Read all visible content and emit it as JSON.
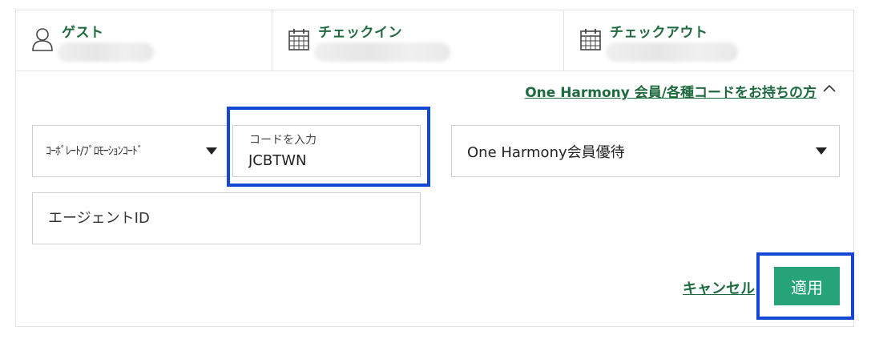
{
  "summary": {
    "guest_label": "ゲスト",
    "checkin_label": "チェックイン",
    "checkout_label": "チェックアウト"
  },
  "member_link": "One Harmony 会員/各種コードをお持ちの方",
  "corporate_select": {
    "selected": "ｺｰﾎﾟﾚｰﾄ/ﾌﾟﾛﾓｰｼｮﾝｺｰﾄﾞ"
  },
  "code_field": {
    "label": "コードを入力",
    "value": "JCBTWN"
  },
  "benefit_select": {
    "selected": "One Harmony会員優待"
  },
  "agent_field": {
    "placeholder": "エージェントID"
  },
  "actions": {
    "cancel": "キャンセル",
    "apply": "適用"
  },
  "colors": {
    "brand_green": "#1f6b3f",
    "apply_bg": "#27a37a",
    "highlight": "#1447d6"
  },
  "icons": [
    "user-icon",
    "calendar-icon",
    "calendar-icon",
    "chevron-up-icon",
    "caret-down-icon"
  ]
}
